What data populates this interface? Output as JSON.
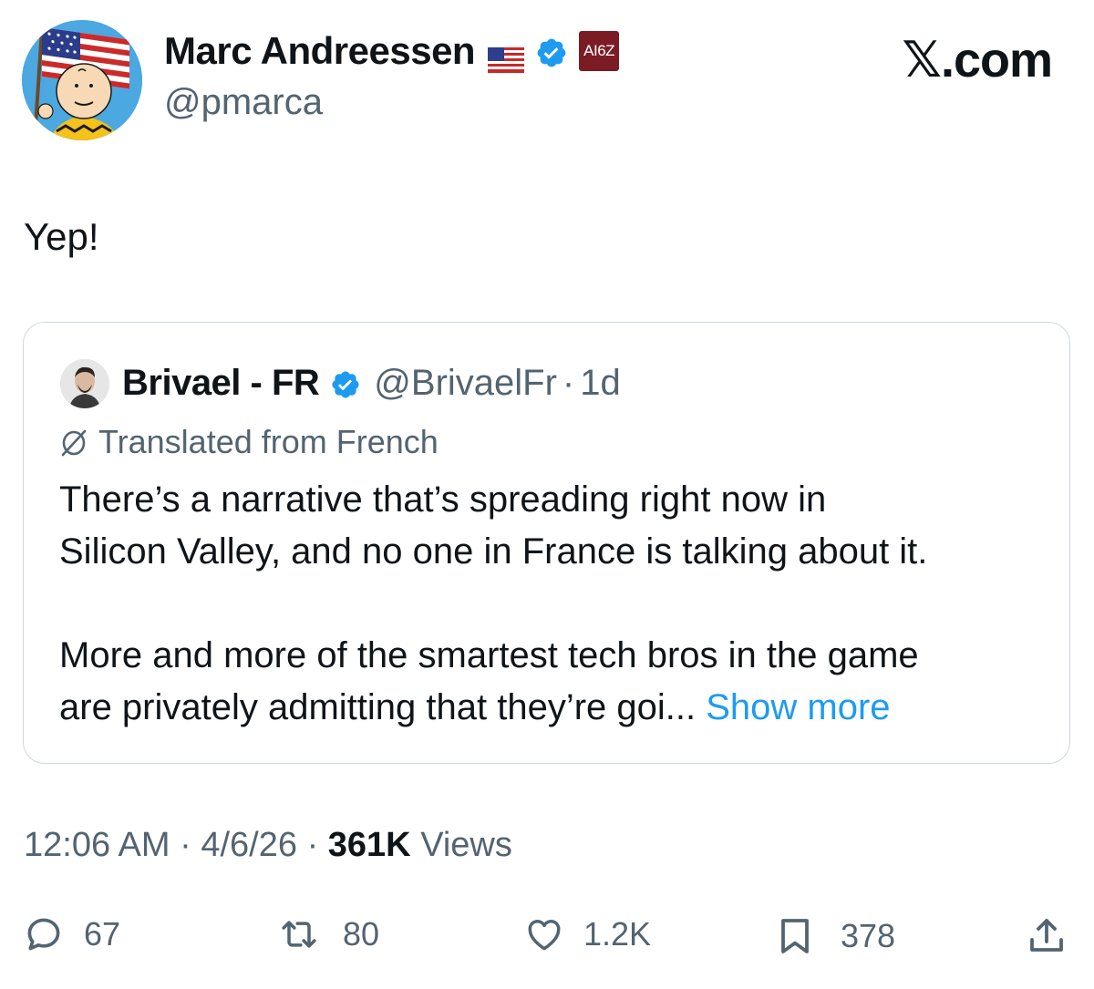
{
  "author": {
    "name": "Marc Andreessen",
    "handle": "@pmarca",
    "badge_text": "AI6Z",
    "flag_icon": "us-flag-icon",
    "verified_icon": "verified-badge-icon"
  },
  "brand": {
    "x": "𝕏",
    "domain": ".com"
  },
  "tweet": {
    "text": "Yep!"
  },
  "quote": {
    "name": "Brivael - FR",
    "handle": "@BrivaelFr",
    "separator": "·",
    "time": "1d",
    "translated_label": "Translated from French",
    "paragraph1_line1": "There’s a narrative that’s spreading right now in",
    "paragraph1_line2": "Silicon Valley, and no one in France is talking about it.",
    "paragraph2_line1": "More and more of the smartest tech bros in the game",
    "paragraph2_line2": "are privately admitting that they’re goi...",
    "show_more": "Show more"
  },
  "meta": {
    "time": "12:06 AM",
    "date": "4/6/26",
    "separator": "·",
    "views_count": "361K",
    "views_label": "Views"
  },
  "actions": {
    "replies": "67",
    "reposts": "80",
    "likes": "1.2K",
    "bookmarks": "378"
  },
  "colors": {
    "text": "#0f1419",
    "secondary": "#536471",
    "link": "#1d9bf0",
    "verified": "#1d9bf0",
    "a16z": "#7b1c25",
    "border": "#cfd9de"
  }
}
